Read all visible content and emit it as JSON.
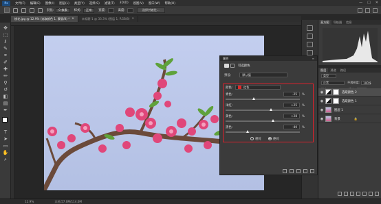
{
  "menu": {
    "logo": "Ps",
    "items": [
      "文件(F)",
      "编辑(E)",
      "图像(I)",
      "图层(L)",
      "类型(Y)",
      "选择(S)",
      "滤镜(T)",
      "3D(D)",
      "视图(V)",
      "窗口(W)",
      "帮助(H)"
    ],
    "window_buttons": [
      "—",
      "□",
      "✕"
    ]
  },
  "options_bar": {
    "feather_label": "羽化:",
    "feather_value": "0 像素",
    "style_label": "样式:",
    "style_value": "正常",
    "width_label": "宽度:",
    "height_label": "高度:",
    "select_mask_button": "选择并遮住..."
  },
  "tabs": [
    {
      "label": "桃花.jpg @ 12.9% (选取颜色 1, 蒙版/8) *",
      "active": true
    },
    {
      "label": "未标题-1 @ 33.3% (图层 1, RGB/8)",
      "active": false
    }
  ],
  "properties": {
    "title": "属性",
    "subtitle": "可选颜色",
    "preset_label": "预设:",
    "preset_value": "默认值",
    "colors_label": "颜色:",
    "colors_value": "红色",
    "rows": [
      {
        "label": "青色:",
        "value": "-25",
        "unit": "%",
        "fraction": 0.38
      },
      {
        "label": "洋红:",
        "value": "+25",
        "unit": "%",
        "fraction": 0.62
      },
      {
        "label": "黄色:",
        "value": "+28",
        "unit": "%",
        "fraction": 0.64
      },
      {
        "label": "黑色:",
        "value": "-40",
        "unit": "%",
        "fraction": 0.3
      }
    ],
    "radio_relative": "相对",
    "radio_absolute": "绝对"
  },
  "histogram_panel": {
    "tabs": [
      "直方图",
      "导航器",
      "信息"
    ]
  },
  "layers_panel": {
    "tabs": [
      "图层",
      "通道",
      "路径"
    ],
    "kind_label": "类型",
    "blend_mode": "正常",
    "opacity_label": "不透明度:",
    "opacity_value": "100%",
    "lock_label": "锁定:",
    "fill_label": "填充:",
    "fill_value": "100%",
    "layers": [
      {
        "name": "选取颜色 2",
        "selected": true,
        "type": "adjustment"
      },
      {
        "name": "选取颜色 1",
        "selected": false,
        "type": "adjustment"
      },
      {
        "name": "图层 1",
        "selected": false,
        "type": "photo"
      },
      {
        "name": "背景",
        "selected": false,
        "type": "photo"
      }
    ]
  },
  "status_bar": {
    "zoom": "12.9%",
    "doc_info": "文档:57.0M/114.0M"
  }
}
